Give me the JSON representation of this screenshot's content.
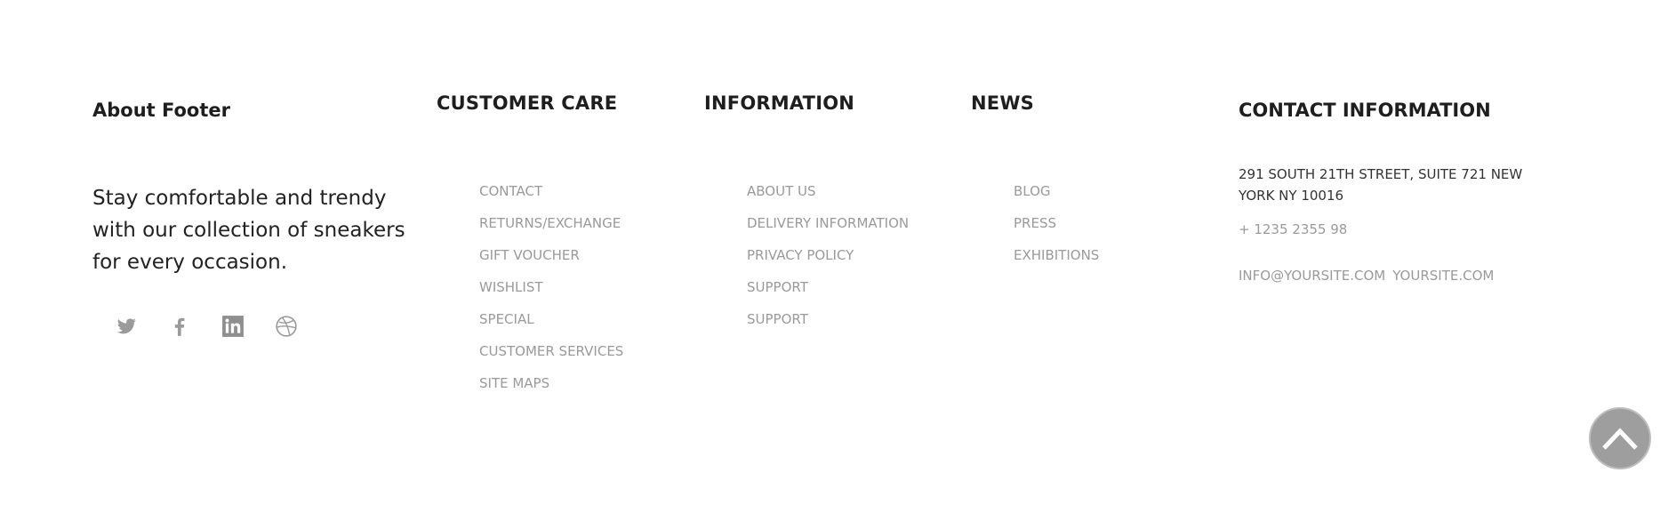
{
  "about": {
    "heading": "About Footer",
    "text": "Stay comfortable and trendy with our collection of sneakers for every occasion.",
    "social": [
      {
        "name": "twitter-icon"
      },
      {
        "name": "facebook-icon"
      },
      {
        "name": "linkedin-icon"
      },
      {
        "name": "dribbble-icon"
      }
    ]
  },
  "customer_care": {
    "title": "CUSTOMER CARE",
    "links": [
      "CONTACT",
      "RETURNS/EXCHANGE",
      "GIFT VOUCHER",
      "WISHLIST",
      "SPECIAL",
      "CUSTOMER SERVICES",
      "SITE MAPS"
    ]
  },
  "information": {
    "title": "INFORMATION",
    "links": [
      "ABOUT US",
      "DELIVERY INFORMATION",
      "PRIVACY POLICY",
      "SUPPORT",
      "SUPPORT"
    ]
  },
  "news": {
    "title": "NEWS",
    "links": [
      "BLOG",
      "PRESS",
      "EXHIBITIONS"
    ]
  },
  "contact": {
    "title": "CONTACT INFORMATION",
    "address": "291 SOUTH 21TH STREET, SUITE 721 NEW YORK NY 10016",
    "phone": "+ 1235 2355 98",
    "email": "INFO@YOURSITE.COM",
    "website": "YOURSITE.COM"
  },
  "scroll_top": {
    "icon": "chevron-up-icon"
  },
  "colors": {
    "link": "#9a9a9a",
    "heading": "#1e1e1e",
    "scroll_button": "#9e9e9e"
  }
}
